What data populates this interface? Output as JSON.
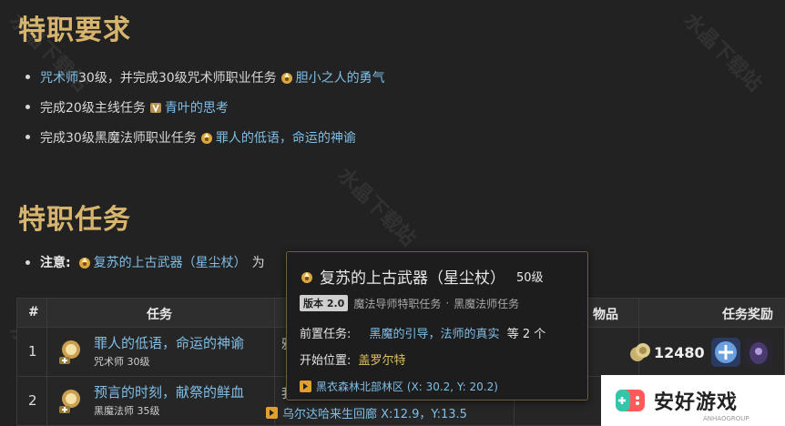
{
  "sections": {
    "requirements_title": "特职要求",
    "tasks_title": "特职任务"
  },
  "requirements": [
    {
      "prefix_link": "咒术师",
      "prefix_text": "30级，并完成30级咒术师职业任务",
      "quest": "胆小之人的勇气"
    },
    {
      "prefix_text": "完成20级主线任务",
      "quest": "青叶的思考"
    },
    {
      "prefix_text": "完成30级黑魔法师职业任务",
      "quest": "罪人的低语，命运的神谕"
    }
  ],
  "note": {
    "label": "注意:",
    "quest": "复苏的上古武器（星尘杖）",
    "trailing": "为"
  },
  "table": {
    "headers": {
      "num": "#",
      "quest": "任务",
      "items": "物品",
      "reward": "任务奖励"
    },
    "rows": [
      {
        "num": "1",
        "name": "罪人的低语，命运的神谕",
        "sub": "咒术师 30级",
        "npc_fragment": "雅"
      },
      {
        "num": "2",
        "name": "预言的时刻，献祭的鲜血",
        "sub": "黑魔法师 35级",
        "npc_fragment": "我"
      }
    ],
    "row2_location": "乌尔达哈来生回廊 X:12.9，Y:13.5",
    "reward_gil": "12480"
  },
  "tooltip": {
    "title": "复苏的上古武器（星尘杖）",
    "level": "50级",
    "version_badge": "版本 2.0",
    "category": "魔法导师特职任务",
    "separator": "·",
    "subcategory": "黑魔法师任务",
    "prereq_label": "前置任务:",
    "prereq_links": "黑魔的引导，法师的真实",
    "prereq_more": "等 2 个",
    "start_label": "开始位置:",
    "start_npc": "盖罗尔特",
    "location": "黑衣森林北部林区 (X: 30.2, Y: 20.2)"
  },
  "watermark": "水晶下载站",
  "ad": {
    "text": "安好游戏",
    "sub": "ANHAOGROUP"
  },
  "colors": {
    "background": "#222222",
    "heading": "#d8b56e",
    "link": "#7fbfe8",
    "npc": "#e0c060"
  }
}
